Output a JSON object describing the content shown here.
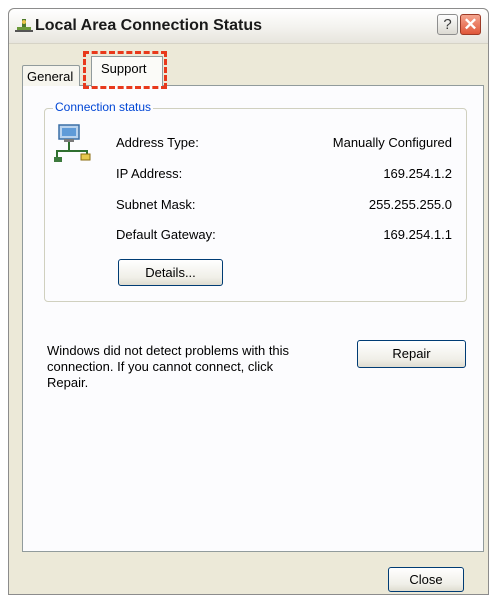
{
  "window": {
    "title": "Local Area Connection Status",
    "icon": "network-connection-icon",
    "help_label": "?",
    "close_label": "✕"
  },
  "tabs": [
    {
      "label": "General",
      "selected": false
    },
    {
      "label": "Support",
      "selected": true
    }
  ],
  "connection_status": {
    "group_label": "Connection status",
    "rows": [
      {
        "label": "Address Type:",
        "value": "Manually Configured"
      },
      {
        "label": "IP Address:",
        "value": "169.254.1.2"
      },
      {
        "label": "Subnet Mask:",
        "value": "255.255.255.0"
      },
      {
        "label": "Default Gateway:",
        "value": "169.254.1.1"
      }
    ],
    "details_label": "Details..."
  },
  "message": "Windows did not detect problems with this connection. If you cannot connect, click Repair.",
  "repair_label": "Repair",
  "close_button_label": "Close",
  "colors": {
    "highlight_dash": "#E8391B",
    "group_label": "#0046D5",
    "button_border": "#003C74"
  }
}
